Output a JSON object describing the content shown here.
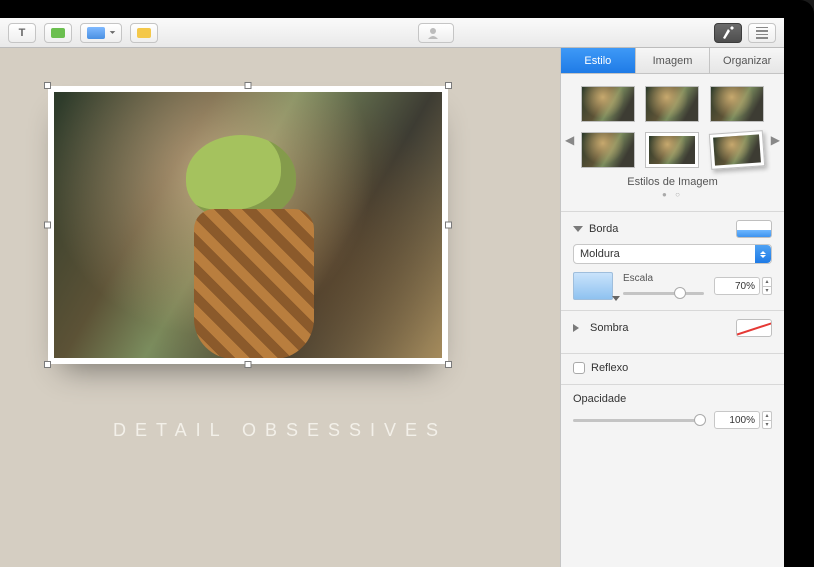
{
  "canvas": {
    "caption": "DETAIL OBSESSIVES"
  },
  "inspector": {
    "tabs": {
      "style": "Estilo",
      "image": "Imagem",
      "arrange": "Organizar"
    },
    "styles_label": "Estilos de Imagem",
    "border": {
      "title": "Borda",
      "type_select": "Moldura",
      "scale_label": "Escala",
      "scale_value": "70%",
      "scale_percent": 70
    },
    "shadow": {
      "title": "Sombra"
    },
    "reflection": {
      "label": "Reflexo"
    },
    "opacity": {
      "title": "Opacidade",
      "value": "100%",
      "percent": 100
    }
  }
}
